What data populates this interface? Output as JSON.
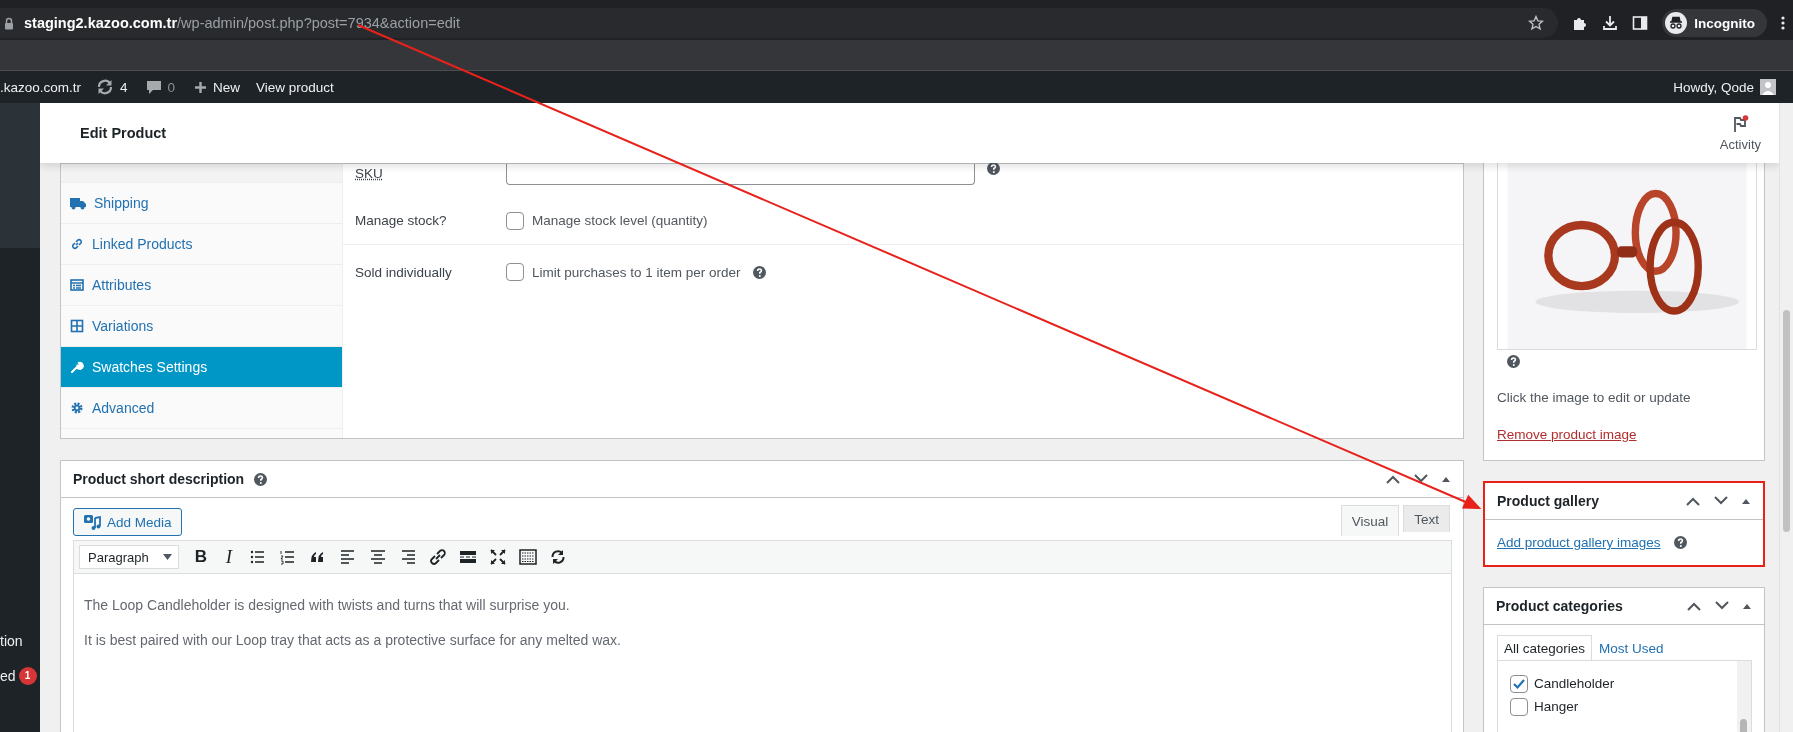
{
  "browser": {
    "url_host": "staging2.kazoo.com.tr",
    "url_path": "/wp-admin/post.php?post=7934&action=edit",
    "profile": "Incognito"
  },
  "admin_bar": {
    "site": ".kazoo.com.tr",
    "updates": "4",
    "comments": "0",
    "new": "New",
    "view": "View product",
    "greeting": "Howdy, Qode"
  },
  "admin_menu": [
    {
      "label": "tion"
    },
    {
      "label": "ed",
      "badge": "1"
    }
  ],
  "page_header": {
    "title": "Edit Product",
    "activity": "Activity",
    "activity_unread": true
  },
  "product_data": {
    "tabs": [
      {
        "label": "Shipping",
        "selected": false
      },
      {
        "label": "Linked Products",
        "selected": false
      },
      {
        "label": "Attributes",
        "selected": false
      },
      {
        "label": "Variations",
        "selected": false
      },
      {
        "label": "Swatches Settings",
        "selected": true
      },
      {
        "label": "Advanced",
        "selected": false
      }
    ],
    "fields": [
      {
        "kind": "text",
        "label": "SKU",
        "help": true
      },
      {
        "kind": "checkbox",
        "label": "Manage stock?",
        "option": "Manage stock level (quantity)",
        "checked": false,
        "help": false
      },
      {
        "kind": "checkbox",
        "label": "Sold individually",
        "option": "Limit purchases to 1 item per order",
        "checked": false,
        "help": true
      }
    ]
  },
  "short_description": {
    "title": "Product short description",
    "add_media": "Add Media",
    "editor_tabs": [
      {
        "label": "Visual",
        "selected": true
      },
      {
        "label": "Text",
        "selected": false
      }
    ],
    "format": "Paragraph",
    "format_buttons": [
      "B",
      "I"
    ],
    "paragraphs": [
      "The Loop Candleholder is designed with twists and turns that will surprise you.",
      "It is best paired with our Loop tray that acts as a protective surface for any melted wax."
    ]
  },
  "featured_image": {
    "hint": "Click the image to edit or update",
    "remove": "Remove product image"
  },
  "gallery": {
    "title": "Product gallery",
    "link": "Add product gallery images",
    "highlighted": true
  },
  "categories": {
    "title": "Product categories",
    "tabs": [
      {
        "label": "All categories",
        "selected": true
      },
      {
        "label": "Most Used",
        "selected": false
      }
    ],
    "items": [
      {
        "label": "Candleholder",
        "checked": true
      },
      {
        "label": "Hanger",
        "checked": false
      }
    ]
  }
}
